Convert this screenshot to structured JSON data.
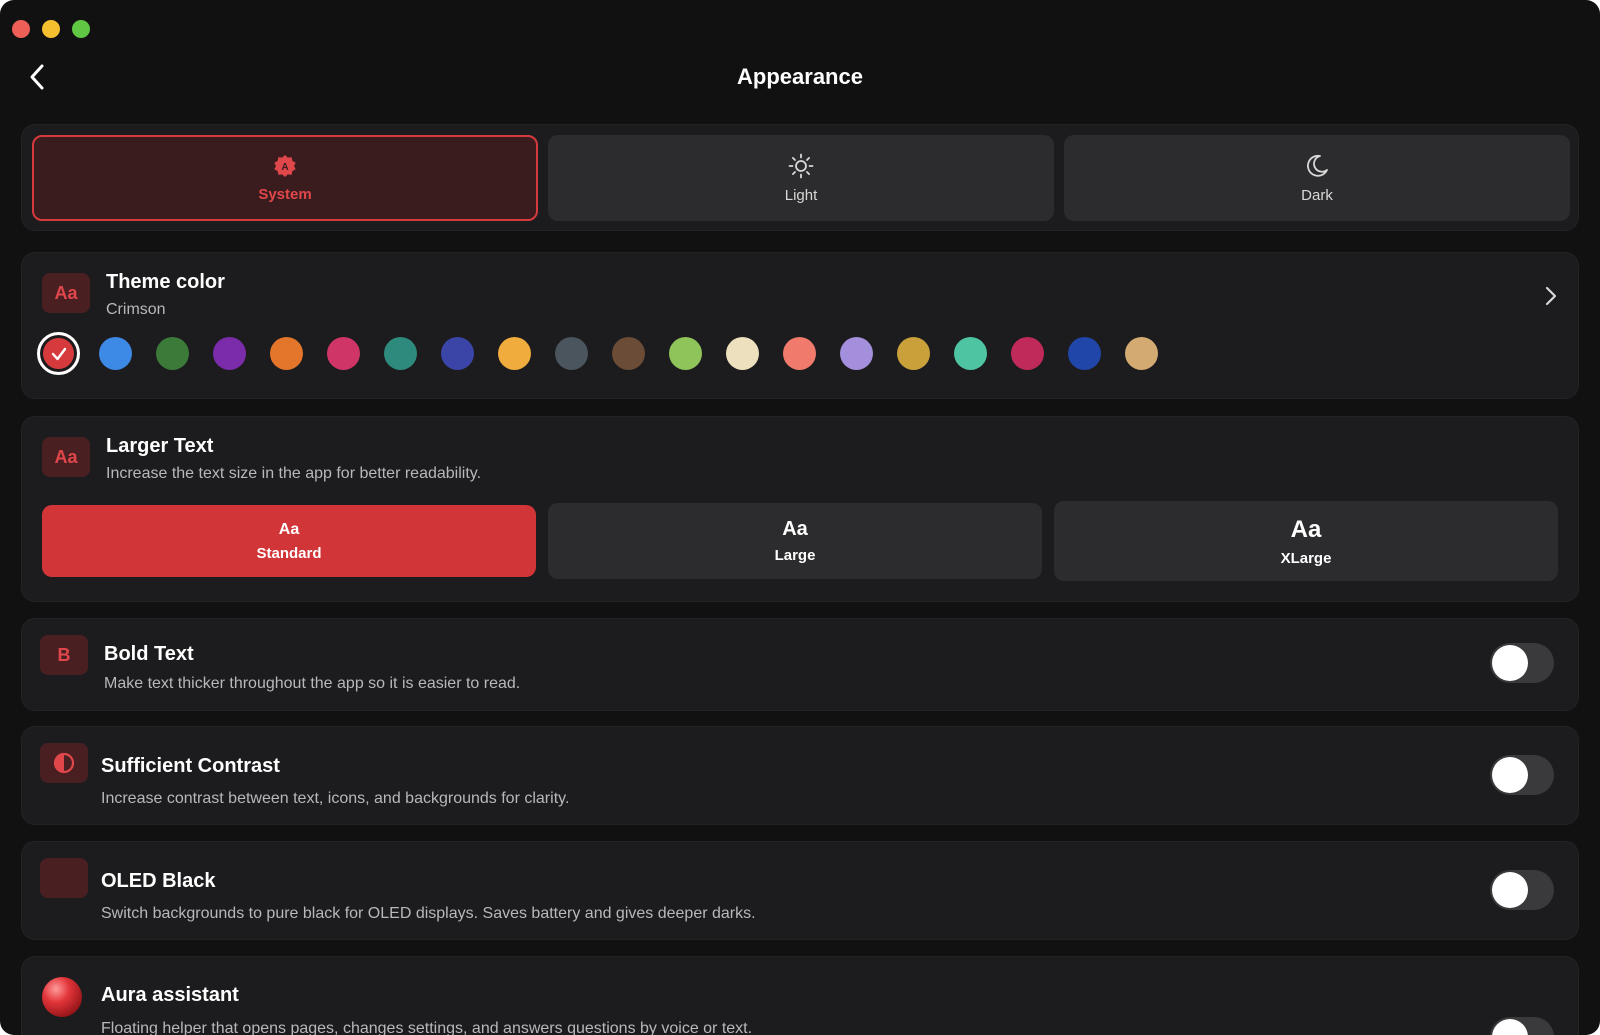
{
  "window": {
    "title": "Appearance",
    "traffic_lights": [
      "close",
      "minimize",
      "zoom"
    ]
  },
  "header": {
    "back_icon": "chevron-left-icon",
    "title": "Appearance"
  },
  "appearance_mode": {
    "options": [
      {
        "label": "System",
        "icon": "system-badge-icon",
        "selected": true
      },
      {
        "label": "Light",
        "icon": "sun-icon",
        "selected": false
      },
      {
        "label": "Dark",
        "icon": "moon-icon",
        "selected": false
      }
    ]
  },
  "theme_color": {
    "icon_text": "Aa",
    "title": "Theme color",
    "current": "Crimson",
    "accent": "#d63a3d",
    "swatches": [
      "#d63a3d",
      "#3d89e6",
      "#3c7a3a",
      "#7b2cab",
      "#e3762b",
      "#cf3567",
      "#2e8a7c",
      "#3b45a8",
      "#f0ad3e",
      "#4a555e",
      "#6b4c36",
      "#8fc45a",
      "#ede0be",
      "#f07a6c",
      "#a48fdc",
      "#c9a03a",
      "#4fc4a2",
      "#c02a5a",
      "#1f46a8",
      "#d2aa72"
    ],
    "selected_index": 0
  },
  "larger_text": {
    "icon_text": "Aa",
    "title": "Larger Text",
    "description": "Increase the text size in the app for better readability.",
    "options": [
      {
        "glyph": "Aa",
        "label": "Standard",
        "selected": true
      },
      {
        "glyph": "Aa",
        "label": "Large",
        "selected": false
      },
      {
        "glyph": "Aa",
        "label": "XLarge",
        "selected": false
      }
    ]
  },
  "bold_text": {
    "icon_text": "B",
    "title": "Bold Text",
    "description": "Make text thicker throughout the app so it is easier to read.",
    "enabled": false
  },
  "sufficient_contrast": {
    "icon": "contrast-icon",
    "title": "Sufficient Contrast",
    "description": "Increase contrast between text, icons, and backgrounds for clarity.",
    "enabled": false
  },
  "oled_black": {
    "icon": "crescent-moon-icon",
    "title": "OLED Black",
    "description": "Switch backgrounds to pure black for OLED displays. Saves battery and gives deeper darks.",
    "enabled": false
  },
  "aura_assistant": {
    "icon": "aura-orb-icon",
    "title": "Aura assistant",
    "description": "Floating helper that opens pages, changes settings, and answers questions by voice or text.",
    "enabled": false
  }
}
